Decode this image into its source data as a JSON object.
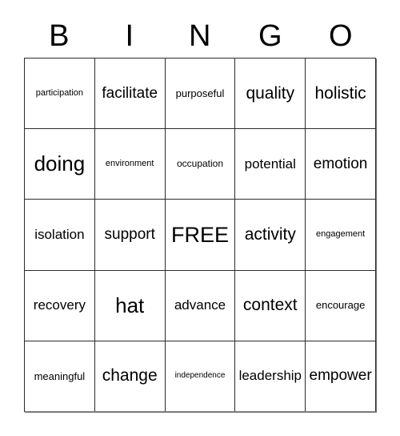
{
  "card": {
    "title": "BINGO",
    "header_letters": [
      "B",
      "I",
      "N",
      "G",
      "O"
    ],
    "free_space_label": "FREE",
    "grid_size": "5x5",
    "colors": {
      "background": "#ffffff",
      "text": "#000000",
      "grid_line": "#2b2b2b",
      "outer_frame": "#7a7a7a"
    },
    "columns": [
      {
        "letter": "B",
        "cells": [
          {
            "text": "participation",
            "size": "xs"
          },
          {
            "text": "doing",
            "size": "xxl"
          },
          {
            "text": "isolation",
            "size": "ml"
          },
          {
            "text": "recovery",
            "size": "ml"
          },
          {
            "text": "meaningful",
            "size": "sm"
          }
        ]
      },
      {
        "letter": "I",
        "cells": [
          {
            "text": "facilitate",
            "size": "l"
          },
          {
            "text": "environment",
            "size": "xs"
          },
          {
            "text": "support",
            "size": "l"
          },
          {
            "text": "hat",
            "size": "xxl"
          },
          {
            "text": "change",
            "size": "xl"
          }
        ]
      },
      {
        "letter": "N",
        "cells": [
          {
            "text": "purposeful",
            "size": "sm"
          },
          {
            "text": "occupation",
            "size": "s"
          },
          {
            "text": "FREE",
            "size": "free"
          },
          {
            "text": "advance",
            "size": "ml"
          },
          {
            "text": "independence",
            "size": "xxs"
          }
        ]
      },
      {
        "letter": "G",
        "cells": [
          {
            "text": "quality",
            "size": "xl"
          },
          {
            "text": "potential",
            "size": "ml"
          },
          {
            "text": "activity",
            "size": "xl"
          },
          {
            "text": "context",
            "size": "xl"
          },
          {
            "text": "leadership",
            "size": "ml"
          }
        ]
      },
      {
        "letter": "O",
        "cells": [
          {
            "text": "holistic",
            "size": "xl"
          },
          {
            "text": "emotion",
            "size": "l"
          },
          {
            "text": "engagement",
            "size": "xs"
          },
          {
            "text": "encourage",
            "size": "sm"
          },
          {
            "text": "empower",
            "size": "l"
          }
        ]
      }
    ],
    "rows": [
      [
        "participation",
        "facilitate",
        "purposeful",
        "quality",
        "holistic"
      ],
      [
        "doing",
        "environment",
        "occupation",
        "potential",
        "emotion"
      ],
      [
        "isolation",
        "support",
        "FREE",
        "activity",
        "engagement"
      ],
      [
        "recovery",
        "hat",
        "advance",
        "context",
        "encourage"
      ],
      [
        "meaningful",
        "change",
        "independence",
        "leadership",
        "empower"
      ]
    ]
  }
}
